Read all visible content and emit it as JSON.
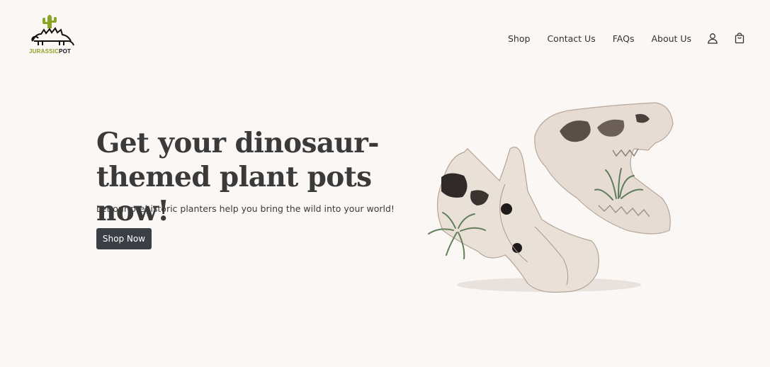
{
  "brand": {
    "logo_prefix": "JURASSIC",
    "logo_suffix": "POT",
    "colors": {
      "green": "#8aa424",
      "dark": "#111111"
    }
  },
  "nav": {
    "items": [
      {
        "label": "Shop"
      },
      {
        "label": "Contact Us"
      },
      {
        "label": "FAQs"
      },
      {
        "label": "About Us"
      }
    ],
    "icons": [
      "user-icon",
      "shopping-bag-icon"
    ]
  },
  "hero": {
    "title": "Get your dinosaur-themed plant pots now!",
    "subtitle": "Let our prehistoric planters help you bring the wild into your world!",
    "cta_label": "Shop Now",
    "cta_color": "#3b3f45",
    "image": "dinosaur-skull-planters-image"
  },
  "page": {
    "background": "#faf7f5"
  }
}
